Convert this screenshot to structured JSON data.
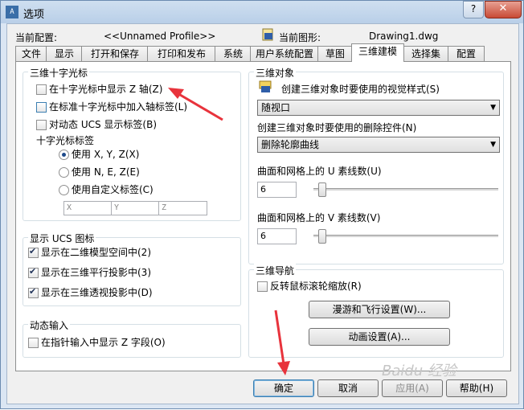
{
  "window": {
    "title": "选项",
    "app_icon": "A"
  },
  "profile": {
    "label": "当前配置:",
    "value": "<<Unnamed Profile>>",
    "drawing_label": "当前图形:",
    "drawing_value": "Drawing1.dwg"
  },
  "tabs": [
    "文件",
    "显示",
    "打开和保存",
    "打印和发布",
    "系统",
    "用户系统配置",
    "草图",
    "三维建模",
    "选择集",
    "配置"
  ],
  "crosshair": {
    "title": "三维十字光标",
    "show_z": "在十字光标中显示 Z 轴(Z)",
    "axis_label": "在标准十字光标中加入轴标签(L)",
    "dyn_ucs": "对动态 UCS 显示标签(B)",
    "labels_title": "十字光标标签",
    "radio_xyz": "使用 X, Y, Z(X)",
    "radio_nez": "使用 N, E, Z(E)",
    "radio_custom": "使用自定义标签(C)",
    "input_x": "X",
    "input_y": "Y",
    "input_z": "Z"
  },
  "ucs": {
    "title": "显示 UCS 图标",
    "in_2d": "显示在二维模型空间中(2)",
    "in_3d_parallel": "显示在三维平行投影中(3)",
    "in_3d_persp": "显示在三维透视投影中(D)"
  },
  "dynamic_input": {
    "title": "动态输入",
    "show_z": "在指针输入中显示 Z 字段(O)"
  },
  "objects": {
    "title": "三维对象",
    "visual_style_label": "创建三维对象时要使用的视觉样式(S)",
    "visual_style_value": "随视口",
    "deletion_label": "创建三维对象时要使用的删除控件(N)",
    "deletion_value": "删除轮廓曲线",
    "u_label": "曲面和网格上的 U 素线数(U)",
    "u_value": "6",
    "v_label": "曲面和网格上的 V 素线数(V)",
    "v_value": "6"
  },
  "navigation": {
    "title": "三维导航",
    "reverse_wheel": "反转鼠标滚轮缩放(R)",
    "walk_fly_button": "漫游和飞行设置(W)...",
    "animation_button": "动画设置(A)..."
  },
  "footer": {
    "ok": "确定",
    "cancel": "取消",
    "apply": "应用(A)",
    "help": "帮助(H)"
  },
  "watermark": "Baidu 经验",
  "colors": {
    "annotation_arrow": "#e8333c",
    "title_bar": "#b9cfe8"
  }
}
